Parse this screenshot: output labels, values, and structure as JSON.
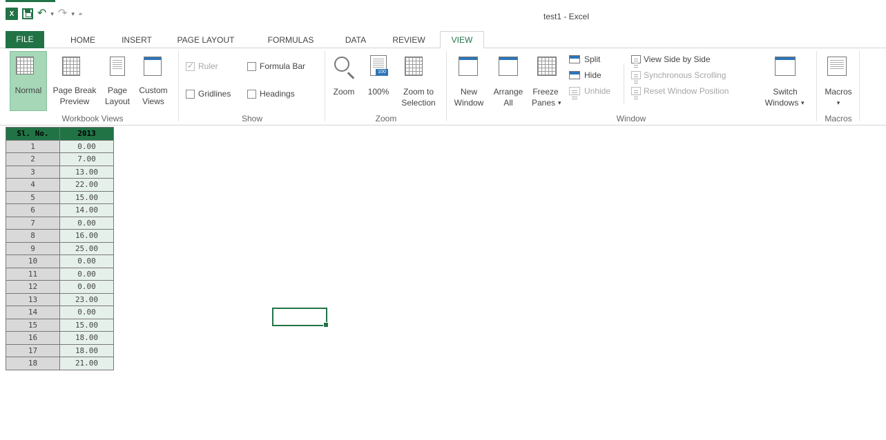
{
  "window": {
    "title": "test1 - Excel"
  },
  "qat": {
    "app_badge": "X"
  },
  "tabs": [
    "FILE",
    "HOME",
    "INSERT",
    "PAGE LAYOUT",
    "FORMULAS",
    "DATA",
    "REVIEW",
    "VIEW"
  ],
  "active_tab": "VIEW",
  "ribbon": {
    "workbook_views": {
      "label": "Workbook Views",
      "normal": "Normal",
      "page_break_1": "Page Break",
      "page_break_2": "Preview",
      "page_layout_1": "Page",
      "page_layout_2": "Layout",
      "custom_1": "Custom",
      "custom_2": "Views"
    },
    "show": {
      "label": "Show",
      "ruler": "Ruler",
      "formula_bar": "Formula Bar",
      "gridlines": "Gridlines",
      "headings": "Headings"
    },
    "zoom": {
      "label": "Zoom",
      "zoom": "Zoom",
      "hundred": "100%",
      "hundred_badge": "100",
      "zoom_sel_1": "Zoom to",
      "zoom_sel_2": "Selection"
    },
    "window": {
      "label": "Window",
      "new_1": "New",
      "new_2": "Window",
      "arrange_1": "Arrange",
      "arrange_2": "All",
      "freeze_1": "Freeze",
      "freeze_2": "Panes",
      "split": "Split",
      "hide": "Hide",
      "unhide": "Unhide",
      "side_by_side": "View Side by Side",
      "sync_scroll": "Synchronous Scrolling",
      "reset_pos": "Reset Window Position",
      "switch_1": "Switch",
      "switch_2": "Windows"
    },
    "macros": {
      "label": "Macros",
      "macros": "Macros"
    }
  },
  "sheet": {
    "headers": [
      "Sl. No.",
      "2013"
    ],
    "rows": [
      [
        "1",
        "0.00"
      ],
      [
        "2",
        "7.00"
      ],
      [
        "3",
        "13.00"
      ],
      [
        "4",
        "22.00"
      ],
      [
        "5",
        "15.00"
      ],
      [
        "6",
        "14.00"
      ],
      [
        "7",
        "0.00"
      ],
      [
        "8",
        "16.00"
      ],
      [
        "9",
        "25.00"
      ],
      [
        "10",
        "0.00"
      ],
      [
        "11",
        "0.00"
      ],
      [
        "12",
        "0.00"
      ],
      [
        "13",
        "23.00"
      ],
      [
        "14",
        "0.00"
      ],
      [
        "15",
        "15.00"
      ],
      [
        "16",
        "18.00"
      ],
      [
        "17",
        "18.00"
      ],
      [
        "18",
        "21.00"
      ]
    ]
  },
  "colors": {
    "accent": "#217346",
    "header_fill": "#217346",
    "sl_fill": "#d9d9d9",
    "val_fill": "#e6f0eb"
  }
}
